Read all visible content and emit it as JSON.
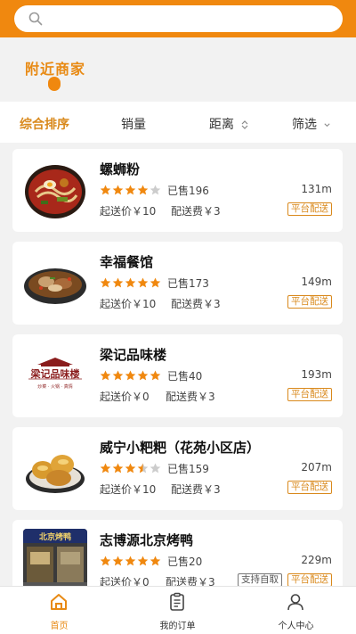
{
  "search": {
    "placeholder": "",
    "icon": "search-icon"
  },
  "section": {
    "title": "附近商家"
  },
  "sort": {
    "items": [
      {
        "label": "综合排序",
        "active": true
      },
      {
        "label": "销量",
        "active": false
      },
      {
        "label": "距离",
        "active": false,
        "icon": "sort-updown-icon"
      },
      {
        "label": "筛选",
        "active": false,
        "icon": "chevron-down-icon"
      }
    ]
  },
  "shops": [
    {
      "name": "螺蛳粉",
      "rating": 4,
      "sold": "已售196",
      "distance": "131m",
      "min_price": "起送价￥10",
      "delivery_fee": "配送费￥3",
      "tags": [
        "平台配送"
      ]
    },
    {
      "name": "幸福餐馆",
      "rating": 5,
      "sold": "已售173",
      "distance": "149m",
      "min_price": "起送价￥10",
      "delivery_fee": "配送费￥3",
      "tags": [
        "平台配送"
      ]
    },
    {
      "name": "梁记品味楼",
      "rating": 5,
      "sold": "已售40",
      "distance": "193m",
      "min_price": "起送价￥0",
      "delivery_fee": "配送费￥3",
      "tags": [
        "平台配送"
      ],
      "logo_text": "梁记品味楼",
      "logo_sub": "炒菜 · 火锅 · 真情"
    },
    {
      "name": "威宁小粑粑（花苑小区店）",
      "rating": 3.5,
      "sold": "已售159",
      "distance": "207m",
      "min_price": "起送价￥10",
      "delivery_fee": "配送费￥3",
      "tags": [
        "平台配送"
      ]
    },
    {
      "name": "志博源北京烤鸭",
      "rating": 5,
      "sold": "已售20",
      "distance": "229m",
      "min_price": "起送价￥0",
      "delivery_fee": "配送费￥3",
      "tags": [
        "支持自取",
        "平台配送"
      ]
    }
  ],
  "nav": {
    "tabs": [
      {
        "label": "首页",
        "icon": "home-icon",
        "active": true
      },
      {
        "label": "我的订单",
        "icon": "orders-icon",
        "active": false
      },
      {
        "label": "个人中心",
        "icon": "user-icon",
        "active": false
      }
    ]
  },
  "colors": {
    "accent": "#f0880f",
    "accent_text": "#d9891c",
    "star": "#f0880f",
    "star_empty": "#cccccc"
  }
}
